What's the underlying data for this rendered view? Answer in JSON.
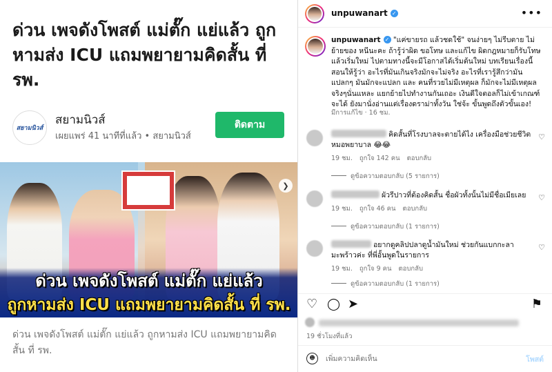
{
  "article": {
    "headline": "ด่วน เพจดังโพสต์ แม่ตั๊ก แย่แล้ว ถูกหามส่ง ICU แถมพยายามคิดสั้น ที่ รพ.",
    "publisher_logo_text": "สยามนิวส์",
    "publisher_name": "สยามนิวส์",
    "publisher_meta": "เผยแพร่ 41 นาทีที่แล้ว • สยามนิวส์",
    "follow_label": "ติดตาม",
    "hero_line1": "ด่วน เพจดังโพสต์ แม่ตั๊ก แย่แล้ว",
    "hero_line2": "ถูกหามส่ง ICU แถมพยายามคิดสั้น ที่ รพ.",
    "caption": "ด่วน เพจดังโพสต์ แม่ตั๊ก แย่แล้ว ถูกหามส่ง ICU แถมพยายามคิดสั้น ที่ รพ."
  },
  "post": {
    "username": "unpuwanart",
    "caption_text": "\"แค่ขายรถ แล้วชดใช้\" จนง่ายๆ ไม่รีบตาย ไม่ย้ายของ หนีนะคะ ถ้ารู้ว่าผิด ขอโทษ และแก้ไข ผิดกฎหมายก็รับโทษแล้วเริ่มใหม่ ไปตามทางนี้จะมีโอกาสได้เริ่มต้นใหม่ บทเรียนเรื่องนี้สอนให้รู้ว่า อะไรที่มันเกินจริงมักจะไม่จริง อะไรที่เรารู้สึกว่ามันแปลกๆ มันมักจะแปลก และ คนที่รวยไม่มีเหตุผล ก็มักจะไม่มีเหตุผลจริงๆนั่นแหละ แยกย้ายไปทำงานกันเถอะ เงินดีใจตอลก็ไม่เข้าเกณฑ์จะได้ ยังมานั่งอ่านแต่เรื่องดราม่าทั้งวัน ใช่จ้ะ ขั้นพูดถึงตัวขั้นเอง!",
    "caption_meta": "มีการแก้ไข · 16 ชม.",
    "comments": [
      {
        "text": "คิดสั้นที่โรงบาลจะตายได้ไง เครื่องมือช่วยชีวิตหมอพยาบาล 😂😂",
        "time": "19 ชม.",
        "likes": "ถูกใจ 142 คน",
        "reply": "ตอบกลับ",
        "replies": "ดูข้อความตอบกลับ (5 รายการ)"
      },
      {
        "text": "ผัวรีปาวที่ต้องคิดสั้น ชื่อผัวทั้งนั้นไม่มีชื่อเมียเลย",
        "time": "19 ชม.",
        "likes": "ถูกใจ 46 คน",
        "reply": "ตอบกลับ",
        "replies": "ดูข้อความตอบกลับ (1 รายการ)"
      },
      {
        "text": "อยากดูคลิปปลาดูน้ำมันใหม่ ช่วยกันแบกกะลามะพร้าวค่ะ ที่พี่อั้นพูดในรายการ",
        "time": "19 ชม.",
        "likes": "ถูกใจ 9 คน",
        "reply": "ตอบกลับ",
        "replies": "ดูข้อความตอบกลับ (1 รายการ)"
      }
    ],
    "time_ago": "19 ชั่วโมงที่แล้ว",
    "comment_placeholder": "เพิ่มความคิดเห็น",
    "post_label": "โพสต์"
  }
}
